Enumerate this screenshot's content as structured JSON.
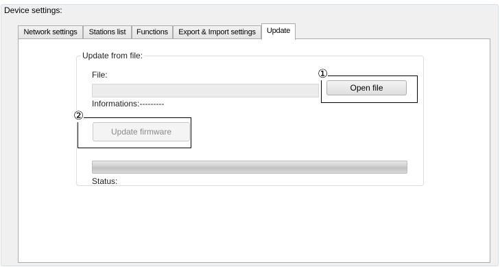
{
  "window": {
    "group_title": "Device settings:"
  },
  "tabs": [
    {
      "label": "Network settings",
      "active": false
    },
    {
      "label": "Stations list",
      "active": false
    },
    {
      "label": "Functions",
      "active": false
    },
    {
      "label": "Export & Import settings",
      "active": false
    },
    {
      "label": "Update",
      "active": true
    }
  ],
  "update_group": {
    "title": "Update from file:",
    "file_label": "File:",
    "file_value": "",
    "informations_label": "Informations:---------",
    "open_file_button": "Open file",
    "update_firmware_button": "Update firmware",
    "progress_fraction": 0,
    "status_label": "Status:"
  },
  "callouts": {
    "one": "①",
    "two": "②"
  },
  "colors": {
    "panel_bg": "#f0f0f0",
    "tab_border": "#acacac",
    "callout": "#000000"
  }
}
